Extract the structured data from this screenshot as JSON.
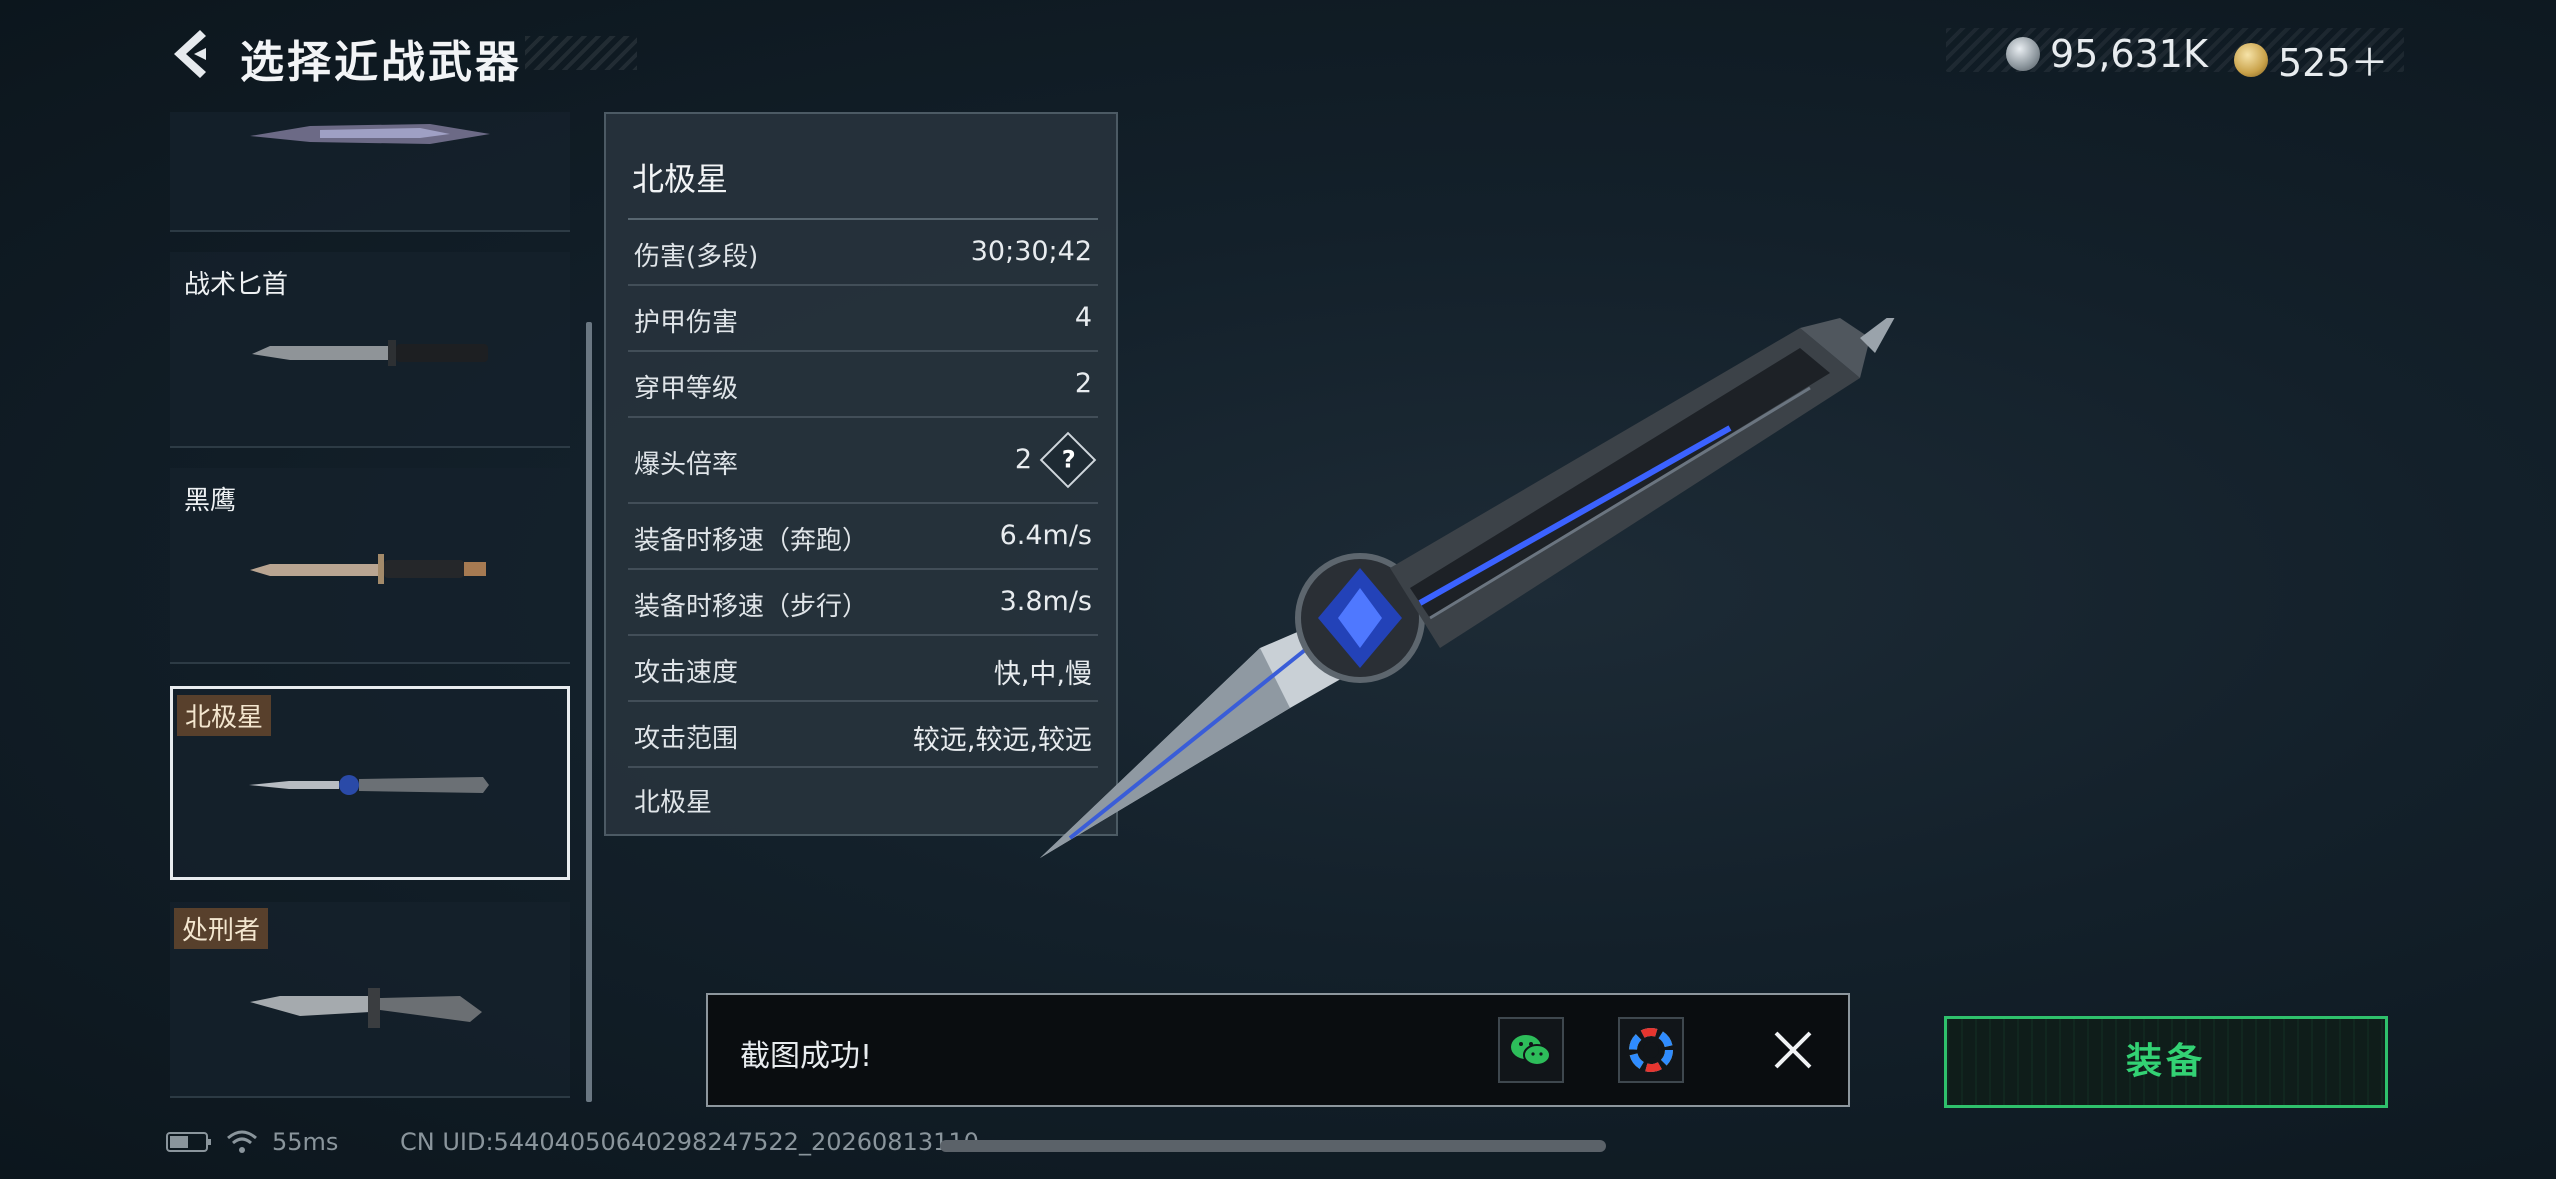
{
  "header": {
    "title": "选择近战武器",
    "currency": [
      {
        "icon": "silver-coin-icon",
        "value": "95,631K"
      },
      {
        "icon": "gold-triangle-coin-icon",
        "value": "525＋"
      }
    ]
  },
  "weapon_list": [
    {
      "label": "",
      "style": "plain"
    },
    {
      "label": "战术匕首",
      "style": "plain"
    },
    {
      "label": "黑鹰",
      "style": "plain"
    },
    {
      "label": "北极星",
      "style": "tag",
      "selected": true
    },
    {
      "label": "处刑者",
      "style": "tag"
    }
  ],
  "stats_panel": {
    "title": "北极星",
    "rows": [
      {
        "label": "伤害(多段)",
        "value": "30;30;42"
      },
      {
        "label": "护甲伤害",
        "value": "4"
      },
      {
        "label": "穿甲等级",
        "value": "2"
      },
      {
        "label": "爆头倍率",
        "value": "2",
        "help": "?"
      },
      {
        "label": "装备时移速（奔跑）",
        "value": "6.4m/s"
      },
      {
        "label": "装备时移速（步行）",
        "value": "3.8m/s"
      },
      {
        "label": "攻击速度",
        "value": "快,中,慢"
      },
      {
        "label": "攻击范围",
        "value": "较远,较远,较远"
      }
    ],
    "footer": "北极星"
  },
  "toast": {
    "message": "截图成功!",
    "share_icons": [
      "wechat-icon",
      "photos-icon"
    ],
    "close_icon": "close-icon"
  },
  "equip_button": "装备",
  "status_bar": {
    "ping": "55ms",
    "uid": "CN UID:5440405064029824​7522_20260813110"
  },
  "colors": {
    "accent_green": "#33d274",
    "background": "#13202a",
    "selected_border": "#e8ecef",
    "tag_bg": "#64462d"
  }
}
